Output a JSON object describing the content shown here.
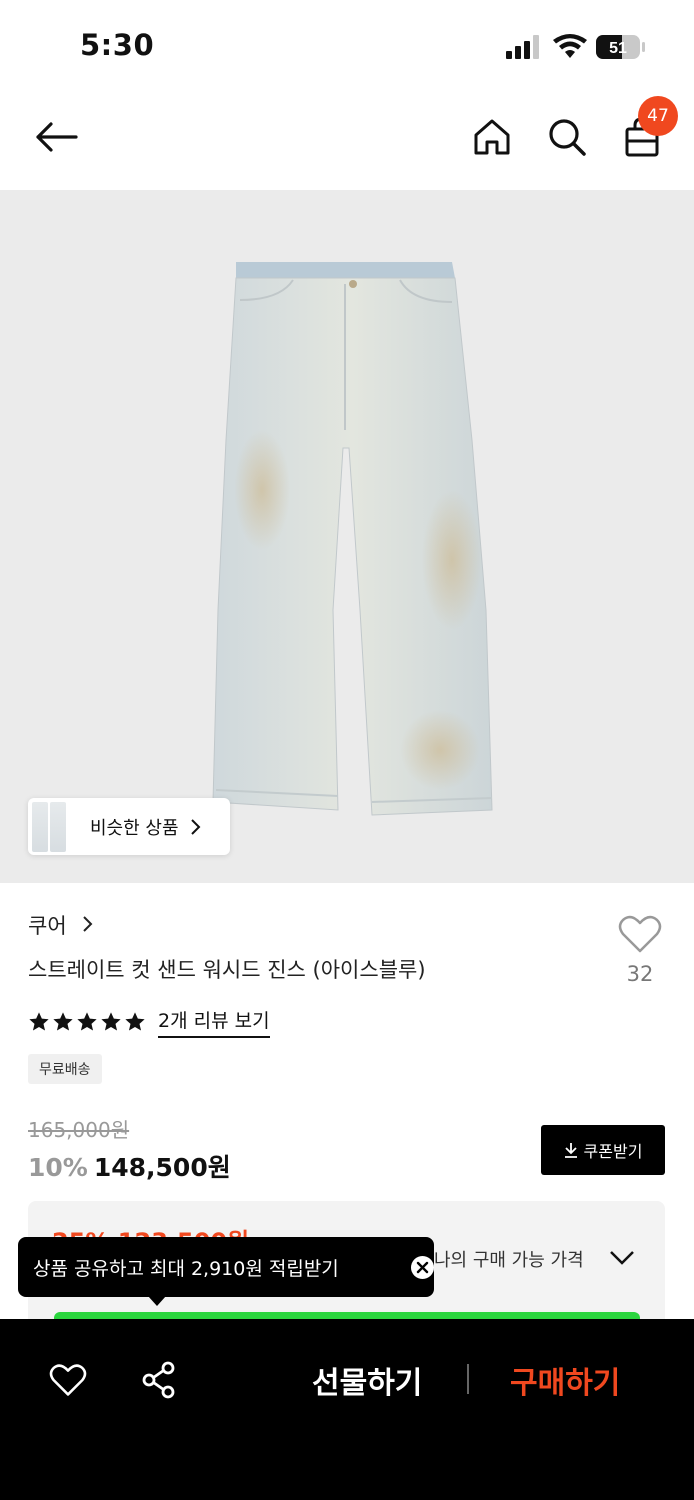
{
  "status_bar": {
    "time": "5:30",
    "battery": "51"
  },
  "header": {
    "cart_count": "47"
  },
  "hero": {
    "similar_label": "비슷한 상품"
  },
  "product": {
    "brand": "쿠어",
    "title": "스트레이트 컷 샌드 워시드 진스 (아이스블루)",
    "like_count": "32",
    "rating_stars": 5,
    "review_link": "2개 리뷰 보기",
    "shipping_badge": "무료배송",
    "original_price": "165,000원",
    "discount_pct": "10%",
    "sale_price": "148,500원",
    "coupon_label": "쿠폰받기"
  },
  "best_price": {
    "label_visible": "나의 구매 가능 가격",
    "peek_text": "25% 123,500원"
  },
  "tooltip": {
    "text": "상품 공유하고 최대 2,910원 적립받기"
  },
  "bottom_bar": {
    "gift_label": "선물하기",
    "buy_label": "구매하기"
  },
  "colors": {
    "accent": "#f0481f",
    "green": "#2bd53e",
    "bar_bg": "#000000",
    "hero_bg": "#ebebeb"
  }
}
